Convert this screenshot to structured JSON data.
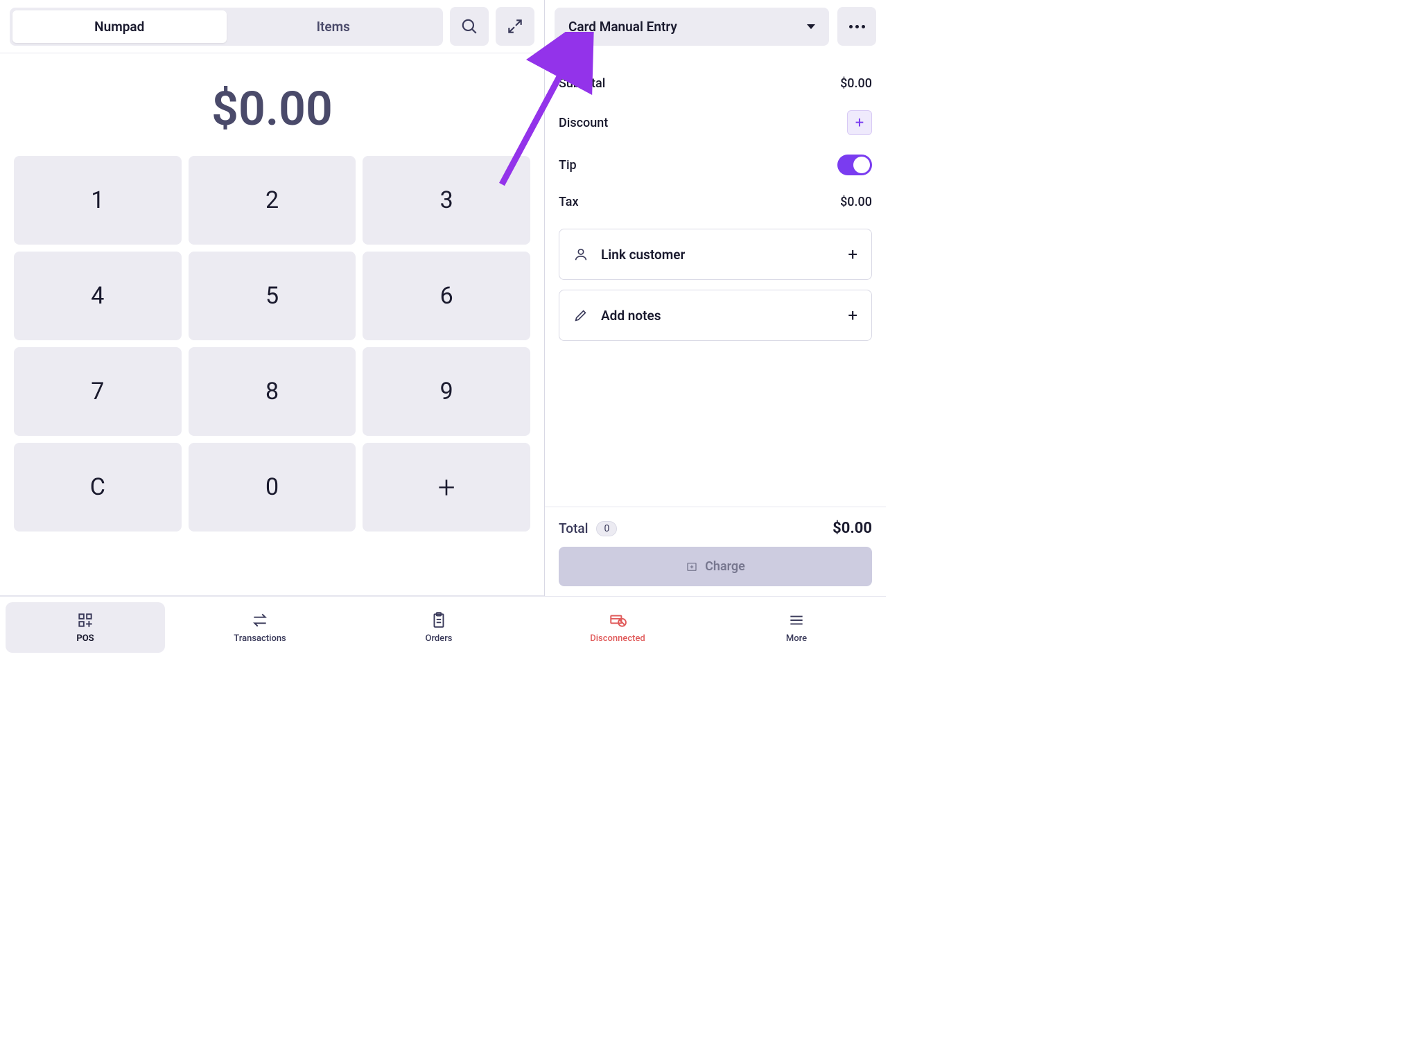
{
  "topbar": {
    "tabs": {
      "numpad": "Numpad",
      "items": "Items"
    }
  },
  "amount": {
    "display": "$0.00"
  },
  "numpad": {
    "k1": "1",
    "k2": "2",
    "k3": "3",
    "k4": "4",
    "k5": "5",
    "k6": "6",
    "k7": "7",
    "k8": "8",
    "k9": "9",
    "clear": "C",
    "k0": "0",
    "plus": "+"
  },
  "checkout": {
    "payment_method": "Card Manual Entry",
    "subtotal": {
      "label": "Subtotal",
      "value": "$0.00"
    },
    "discount": {
      "label": "Discount"
    },
    "tip": {
      "label": "Tip",
      "enabled": true
    },
    "tax": {
      "label": "Tax",
      "value": "$0.00"
    },
    "link_customer": "Link customer",
    "add_notes": "Add notes"
  },
  "total": {
    "label": "Total",
    "count": "0",
    "value": "$0.00",
    "charge_label": "Charge"
  },
  "nav": {
    "pos": "POS",
    "transactions": "Transactions",
    "orders": "Orders",
    "disconnected": "Disconnected",
    "more": "More"
  }
}
